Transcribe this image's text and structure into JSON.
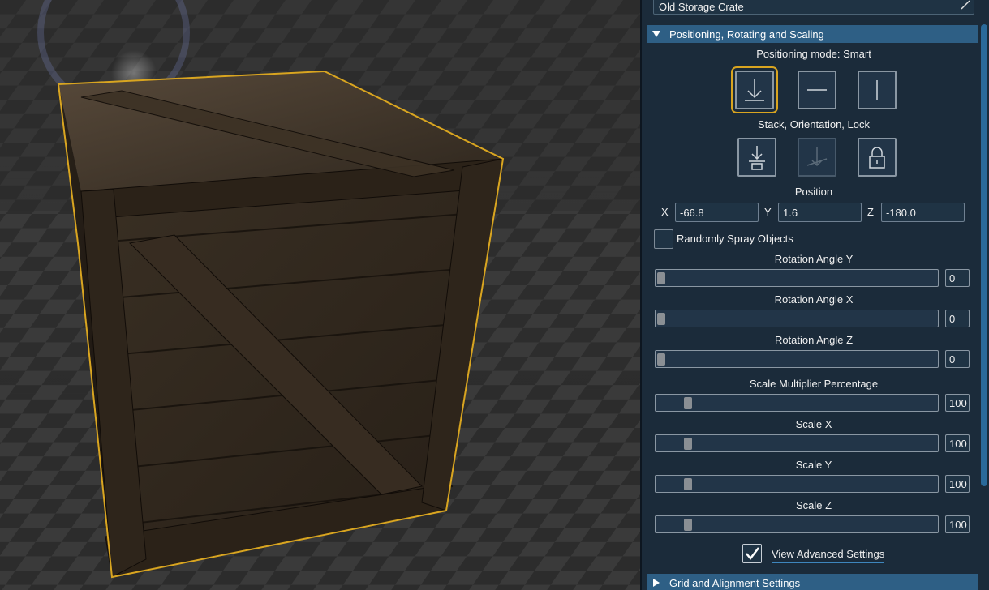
{
  "object_name": "Old Storage Crate",
  "section_positioning": {
    "title": "Positioning, Rotating and Scaling",
    "expanded": true,
    "positioning_mode_label": "Positioning mode: Smart",
    "mode_buttons": [
      {
        "name": "smart-mode-icon",
        "selected": true
      },
      {
        "name": "horizontal-mode-icon",
        "selected": false
      },
      {
        "name": "vertical-mode-icon",
        "selected": false
      }
    ],
    "stack_label": "Stack, Orientation, Lock",
    "stack_buttons": [
      {
        "name": "stack-icon",
        "enabled": true
      },
      {
        "name": "orientation-icon",
        "enabled": false
      },
      {
        "name": "lock-icon",
        "enabled": true
      }
    ],
    "position_label": "Position",
    "position": {
      "x_label": "X",
      "x": "-66.8",
      "y_label": "Y",
      "y": "1.6",
      "z_label": "Z",
      "z": "-180.0"
    },
    "spray_label": "Randomly Spray Objects",
    "spray_checked": false,
    "sliders": [
      {
        "label": "Rotation Angle Y",
        "value": "0",
        "fraction": 0.0
      },
      {
        "label": "Rotation Angle X",
        "value": "0",
        "fraction": 0.0
      },
      {
        "label": "Rotation Angle Z",
        "value": "0",
        "fraction": 0.0
      },
      {
        "label": "Scale Multiplier Percentage",
        "value": "100",
        "fraction": 0.1
      },
      {
        "label": "Scale X",
        "value": "100",
        "fraction": 0.1
      },
      {
        "label": "Scale Y",
        "value": "100",
        "fraction": 0.1
      },
      {
        "label": "Scale Z",
        "value": "100",
        "fraction": 0.1
      }
    ],
    "advanced_checked": true,
    "advanced_label": "View Advanced Settings"
  },
  "section_grid": {
    "title": "Grid and Alignment Settings",
    "expanded": false
  },
  "colors": {
    "selection_outline": "#d9a520",
    "header_bg": "#2e5f85",
    "panel_bg": "#1b2b3a"
  }
}
